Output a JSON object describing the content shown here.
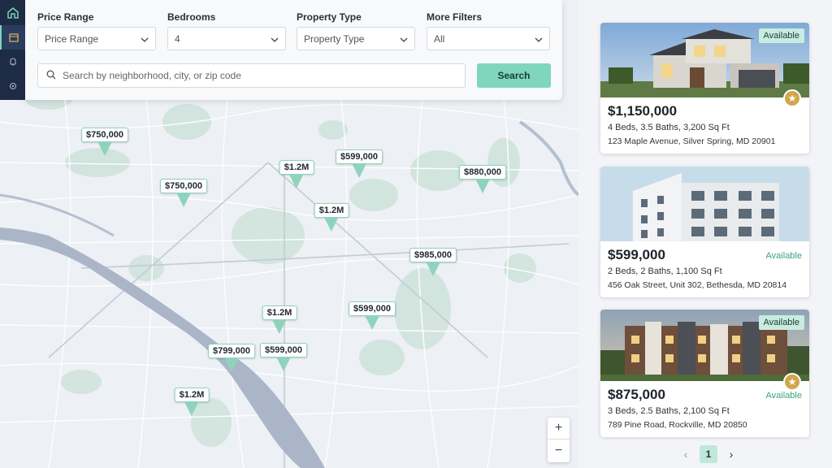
{
  "filters": {
    "price_range": {
      "label": "Price Range",
      "value": "Price Range"
    },
    "bedrooms": {
      "label": "Bedrooms",
      "value": "4"
    },
    "property_type": {
      "label": "Property Type",
      "value": "Property Type"
    },
    "more_filters": {
      "label": "More Filters",
      "value": "All"
    },
    "search": {
      "placeholder": "Search by neighborhood, city, or zip code",
      "button_label": "Search"
    }
  },
  "markers": [
    {
      "label": "$750,000"
    },
    {
      "label": "$750,000"
    },
    {
      "label": "$1.2M"
    },
    {
      "label": "$599,000"
    },
    {
      "label": "$880,000"
    },
    {
      "label": "$1.2M"
    },
    {
      "label": "$985,000"
    },
    {
      "label": "$1.2M"
    },
    {
      "label": "$599,000"
    },
    {
      "label": "$799,000"
    },
    {
      "label": "$599,000"
    },
    {
      "label": "$1.2M"
    }
  ],
  "zoom": {
    "in": "+",
    "out": "−"
  },
  "listings": [
    {
      "price": "$1,150,000",
      "details": "4 Beds, 3.5 Baths, 3,200 Sq Ft",
      "address": "123 Maple Avenue, Silver Spring, MD 20901",
      "status": "Available"
    },
    {
      "price": "$599,000",
      "details": "2 Beds, 2 Baths, 1,100 Sq Ft",
      "address": "456 Oak Street, Unit 302, Bethesda, MD 20814",
      "status": "Available"
    },
    {
      "price": "$875,000",
      "details": "3 Beds, 2.5 Baths, 2,100 Sq Ft",
      "address": "789 Pine Road, Rockville, MD 20850",
      "status": "Available",
      "status2": "Available"
    }
  ],
  "pagination": {
    "current": "1",
    "prev": "‹",
    "next": "›"
  },
  "colors": {
    "accent": "#7fd6bb",
    "rail": "#1d2b45",
    "marker": "#8fd3bd",
    "star": "#d2a64c"
  }
}
